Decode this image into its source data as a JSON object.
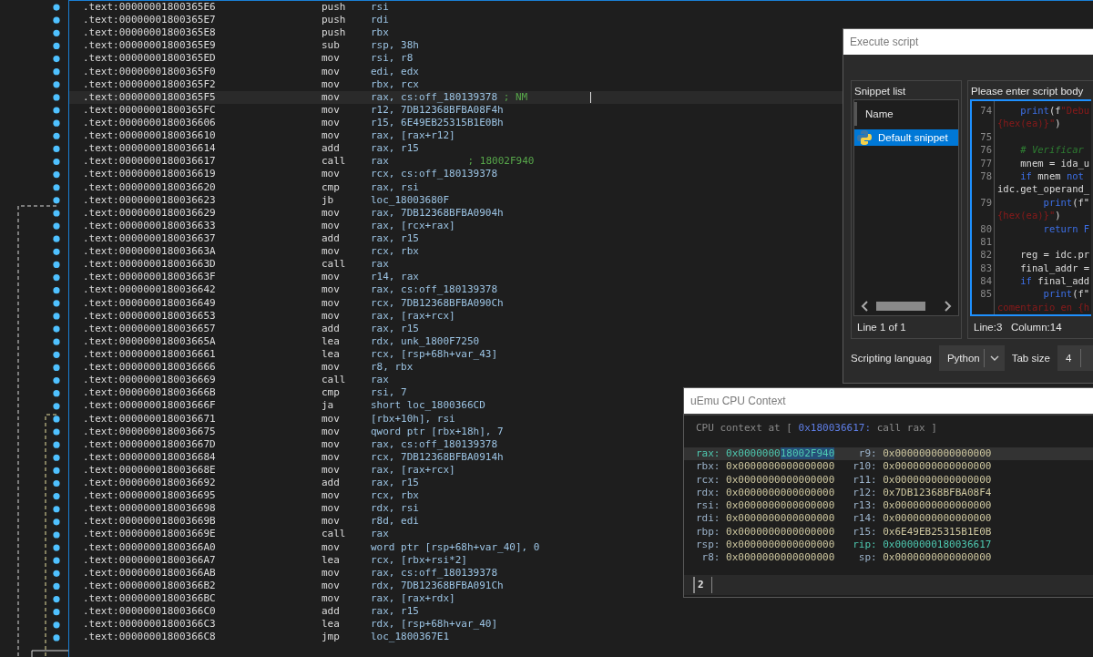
{
  "listing": {
    "rows": [
      {
        "address": ".text:00000001800365E6",
        "mnemonic": "push",
        "operands": "rsi",
        "selected": false
      },
      {
        "address": ".text:00000001800365E7",
        "mnemonic": "push",
        "operands": "rdi",
        "selected": false
      },
      {
        "address": ".text:00000001800365E8",
        "mnemonic": "push",
        "operands": "rbx",
        "selected": false
      },
      {
        "address": ".text:00000001800365E9",
        "mnemonic": "sub",
        "operands": "rsp, 38h",
        "selected": false
      },
      {
        "address": ".text:00000001800365ED",
        "mnemonic": "mov",
        "operands": "rsi, r8",
        "selected": false
      },
      {
        "address": ".text:00000001800365F0",
        "mnemonic": "mov",
        "operands": "edi, edx",
        "selected": false
      },
      {
        "address": ".text:00000001800365F2",
        "mnemonic": "mov",
        "operands": "rbx, rcx",
        "selected": false
      },
      {
        "address": ".text:00000001800365F5",
        "mnemonic": "mov",
        "operands": "rax, cs:off_180139378",
        "comment": "; NM",
        "selected": true
      },
      {
        "address": ".text:00000001800365FC",
        "mnemonic": "mov",
        "operands": "r12, 7DB12368BFBA08F4h",
        "selected": false
      },
      {
        "address": ".text:0000000180036606",
        "mnemonic": "mov",
        "operands": "r15, 6E49EB25315B1E0Bh",
        "selected": false
      },
      {
        "address": ".text:0000000180036610",
        "mnemonic": "mov",
        "operands": "rax, [rax+r12]",
        "selected": false
      },
      {
        "address": ".text:0000000180036614",
        "mnemonic": "add",
        "operands": "rax, r15",
        "selected": false
      },
      {
        "address": ".text:0000000180036617",
        "mnemonic": "call",
        "operands": "rax",
        "comment": "; 18002F940",
        "selected": false
      },
      {
        "address": ".text:0000000180036619",
        "mnemonic": "mov",
        "operands": "rcx, cs:off_180139378",
        "selected": false
      },
      {
        "address": ".text:0000000180036620",
        "mnemonic": "cmp",
        "operands": "rax, rsi",
        "selected": false
      },
      {
        "address": ".text:0000000180036623",
        "mnemonic": "jb",
        "operands": "loc_18003680F",
        "selected": false
      },
      {
        "address": ".text:0000000180036629",
        "mnemonic": "mov",
        "operands": "rax, 7DB12368BFBA0904h",
        "selected": false
      },
      {
        "address": ".text:0000000180036633",
        "mnemonic": "mov",
        "operands": "rax, [rcx+rax]",
        "selected": false
      },
      {
        "address": ".text:0000000180036637",
        "mnemonic": "add",
        "operands": "rax, r15",
        "selected": false
      },
      {
        "address": ".text:000000018003663A",
        "mnemonic": "mov",
        "operands": "rcx, rbx",
        "selected": false
      },
      {
        "address": ".text:000000018003663D",
        "mnemonic": "call",
        "operands": "rax",
        "selected": false
      },
      {
        "address": ".text:000000018003663F",
        "mnemonic": "mov",
        "operands": "r14, rax",
        "selected": false
      },
      {
        "address": ".text:0000000180036642",
        "mnemonic": "mov",
        "operands": "rax, cs:off_180139378",
        "selected": false
      },
      {
        "address": ".text:0000000180036649",
        "mnemonic": "mov",
        "operands": "rcx, 7DB12368BFBA090Ch",
        "selected": false
      },
      {
        "address": ".text:0000000180036653",
        "mnemonic": "mov",
        "operands": "rax, [rax+rcx]",
        "selected": false
      },
      {
        "address": ".text:0000000180036657",
        "mnemonic": "add",
        "operands": "rax, r15",
        "selected": false
      },
      {
        "address": ".text:000000018003665A",
        "mnemonic": "lea",
        "operands": "rdx, unk_1800F7250",
        "selected": false
      },
      {
        "address": ".text:0000000180036661",
        "mnemonic": "lea",
        "operands": "rcx, [rsp+68h+var_43]",
        "selected": false
      },
      {
        "address": ".text:0000000180036666",
        "mnemonic": "mov",
        "operands": "r8, rbx",
        "selected": false
      },
      {
        "address": ".text:0000000180036669",
        "mnemonic": "call",
        "operands": "rax",
        "selected": false
      },
      {
        "address": ".text:000000018003666B",
        "mnemonic": "cmp",
        "operands": "rsi, 7",
        "selected": false
      },
      {
        "address": ".text:000000018003666F",
        "mnemonic": "ja",
        "operands": "short loc_1800366CD",
        "selected": false
      },
      {
        "address": ".text:0000000180036671",
        "mnemonic": "mov",
        "operands": "[rbx+10h], rsi",
        "selected": false
      },
      {
        "address": ".text:0000000180036675",
        "mnemonic": "mov",
        "operands": "qword ptr [rbx+18h], 7",
        "selected": false
      },
      {
        "address": ".text:000000018003667D",
        "mnemonic": "mov",
        "operands": "rax, cs:off_180139378",
        "selected": false
      },
      {
        "address": ".text:0000000180036684",
        "mnemonic": "mov",
        "operands": "rcx, 7DB12368BFBA0914h",
        "selected": false
      },
      {
        "address": ".text:000000018003668E",
        "mnemonic": "mov",
        "operands": "rax, [rax+rcx]",
        "selected": false
      },
      {
        "address": ".text:0000000180036692",
        "mnemonic": "add",
        "operands": "rax, r15",
        "selected": false
      },
      {
        "address": ".text:0000000180036695",
        "mnemonic": "mov",
        "operands": "rcx, rbx",
        "selected": false
      },
      {
        "address": ".text:0000000180036698",
        "mnemonic": "mov",
        "operands": "rdx, rsi",
        "selected": false
      },
      {
        "address": ".text:000000018003669B",
        "mnemonic": "mov",
        "operands": "r8d, edi",
        "selected": false
      },
      {
        "address": ".text:000000018003669E",
        "mnemonic": "call",
        "operands": "rax",
        "selected": false
      },
      {
        "address": ".text:00000001800366A0",
        "mnemonic": "mov",
        "operands": "word ptr [rsp+68h+var_40], 0",
        "selected": false
      },
      {
        "address": ".text:00000001800366A7",
        "mnemonic": "lea",
        "operands": "rcx, [rbx+rsi*2]",
        "selected": false
      },
      {
        "address": ".text:00000001800366AB",
        "mnemonic": "mov",
        "operands": "rax, cs:off_180139378",
        "selected": false
      },
      {
        "address": ".text:00000001800366B2",
        "mnemonic": "mov",
        "operands": "rdx, 7DB12368BFBA091Ch",
        "selected": false
      },
      {
        "address": ".text:00000001800366BC",
        "mnemonic": "mov",
        "operands": "rax, [rax+rdx]",
        "selected": false
      },
      {
        "address": ".text:00000001800366C0",
        "mnemonic": "add",
        "operands": "rax, r15",
        "selected": false
      },
      {
        "address": ".text:00000001800366C3",
        "mnemonic": "lea",
        "operands": "rdx, [rsp+68h+var_40]",
        "selected": false
      },
      {
        "address": ".text:00000001800366C8",
        "mnemonic": "jmp",
        "operands": "loc_1800367E1",
        "selected": false
      }
    ]
  },
  "execute_script": {
    "title": "Execute script",
    "snippet_list": {
      "label": "Snippet list",
      "column": "Name",
      "items": [
        {
          "name": "Default snippet",
          "selected": true
        }
      ],
      "status": "Line 1 of 1"
    },
    "script_body": {
      "label": "Please enter script body",
      "lines": [
        {
          "number": "74",
          "kind": "block",
          "segments": [
            {
              "kind": "keyword",
              "text": "print"
            },
            {
              "kind": "plain",
              "text": "(f"
            },
            {
              "kind": "string",
              "text": "\"Debu"
            }
          ]
        },
        {
          "segments": [
            {
              "kind": "string",
              "text": "{hex(ea)}\""
            },
            {
              "kind": "plain",
              "text": ")"
            }
          ]
        },
        {
          "number": "75"
        },
        {
          "number": "76",
          "kind": "block",
          "segments": [
            {
              "kind": "comment",
              "text": "# Verificar"
            }
          ]
        },
        {
          "number": "77",
          "kind": "block",
          "segments": [
            {
              "kind": "plain",
              "text": "mnem = ida_u"
            }
          ]
        },
        {
          "number": "78",
          "kind": "block",
          "segments": [
            {
              "kind": "keyword",
              "text": "if"
            },
            {
              "kind": "plain",
              "text": " mnem "
            },
            {
              "kind": "keyword",
              "text": "not"
            }
          ]
        },
        {
          "segments": [
            {
              "kind": "plain",
              "text": "idc.get_operand_"
            }
          ]
        },
        {
          "number": "79",
          "kind": "inner",
          "segments": [
            {
              "kind": "keyword",
              "text": "print"
            },
            {
              "kind": "plain",
              "text": "(f\""
            }
          ]
        },
        {
          "segments": [
            {
              "kind": "string",
              "text": "{hex(ea)}\""
            },
            {
              "kind": "plain",
              "text": ")"
            }
          ]
        },
        {
          "number": "80",
          "kind": "inner",
          "segments": [
            {
              "kind": "keyword",
              "text": "return F"
            }
          ]
        },
        {
          "number": "81"
        },
        {
          "number": "82",
          "kind": "block",
          "segments": [
            {
              "kind": "plain",
              "text": "reg = idc.pr"
            }
          ]
        },
        {
          "number": "83",
          "kind": "block",
          "segments": [
            {
              "kind": "plain",
              "text": "final_addr ="
            }
          ]
        },
        {
          "number": "84",
          "kind": "block",
          "segments": [
            {
              "kind": "keyword",
              "text": "if"
            },
            {
              "kind": "plain",
              "text": " final_add"
            }
          ]
        },
        {
          "number": "85",
          "kind": "inner",
          "segments": [
            {
              "kind": "keyword",
              "text": "print"
            },
            {
              "kind": "plain",
              "text": "(f\""
            }
          ]
        },
        {
          "segments": [
            {
              "kind": "string",
              "text": "comentario en {h"
            }
          ]
        }
      ],
      "status_line": "Line:3",
      "status_column": "Column:14"
    },
    "language": {
      "label": "Scripting languag",
      "value": "Python"
    },
    "tab_size": {
      "label": "Tab size",
      "value": "4"
    }
  },
  "cpu_context": {
    "title": "uEmu CPU Context",
    "header_prefix": "CPU context at [",
    "header_address": "0x180036617:",
    "header_suffix": "call rax ]",
    "rows": [
      {
        "selected": true,
        "left": {
          "name": "rax:",
          "changed": true,
          "value_parts": [
            {
              "text": "0x0000000",
              "selected": false
            },
            {
              "text": "18002F940",
              "selected": true
            }
          ]
        },
        "right": {
          "name": "r9:",
          "changed": false,
          "value": "0x0000000000000000"
        }
      },
      {
        "selected": false,
        "left": {
          "name": "rbx:",
          "changed": false,
          "value": "0x0000000000000000"
        },
        "right": {
          "name": "r10:",
          "changed": false,
          "value": "0x0000000000000000"
        }
      },
      {
        "selected": false,
        "left": {
          "name": "rcx:",
          "changed": false,
          "value": "0x0000000000000000"
        },
        "right": {
          "name": "r11:",
          "changed": false,
          "value": "0x0000000000000000"
        }
      },
      {
        "selected": false,
        "left": {
          "name": "rdx:",
          "changed": false,
          "value": "0x0000000000000000"
        },
        "right": {
          "name": "r12:",
          "changed": false,
          "value": "0x7DB12368BFBA08F4"
        }
      },
      {
        "selected": false,
        "left": {
          "name": "rsi:",
          "changed": false,
          "value": "0x0000000000000000"
        },
        "right": {
          "name": "r13:",
          "changed": false,
          "value": "0x0000000000000000"
        }
      },
      {
        "selected": false,
        "left": {
          "name": "rdi:",
          "changed": false,
          "value": "0x0000000000000000"
        },
        "right": {
          "name": "r14:",
          "changed": false,
          "value": "0x0000000000000000"
        }
      },
      {
        "selected": false,
        "left": {
          "name": "rbp:",
          "changed": false,
          "value": "0x0000000000000000"
        },
        "right": {
          "name": "r15:",
          "changed": false,
          "value": "0x6E49EB25315B1E0B"
        }
      },
      {
        "selected": false,
        "left": {
          "name": "rsp:",
          "changed": false,
          "value": "0x0000000000000000"
        },
        "right": {
          "name": "rip:",
          "changed": true,
          "value": "0x0000000180036617"
        }
      },
      {
        "selected": false,
        "left": {
          "name": "r8:",
          "changed": false,
          "value": "0x0000000000000000"
        },
        "right": {
          "name": "sp:",
          "changed": false,
          "value": "0x0000000000000000"
        }
      }
    ],
    "console_tab": "2"
  }
}
